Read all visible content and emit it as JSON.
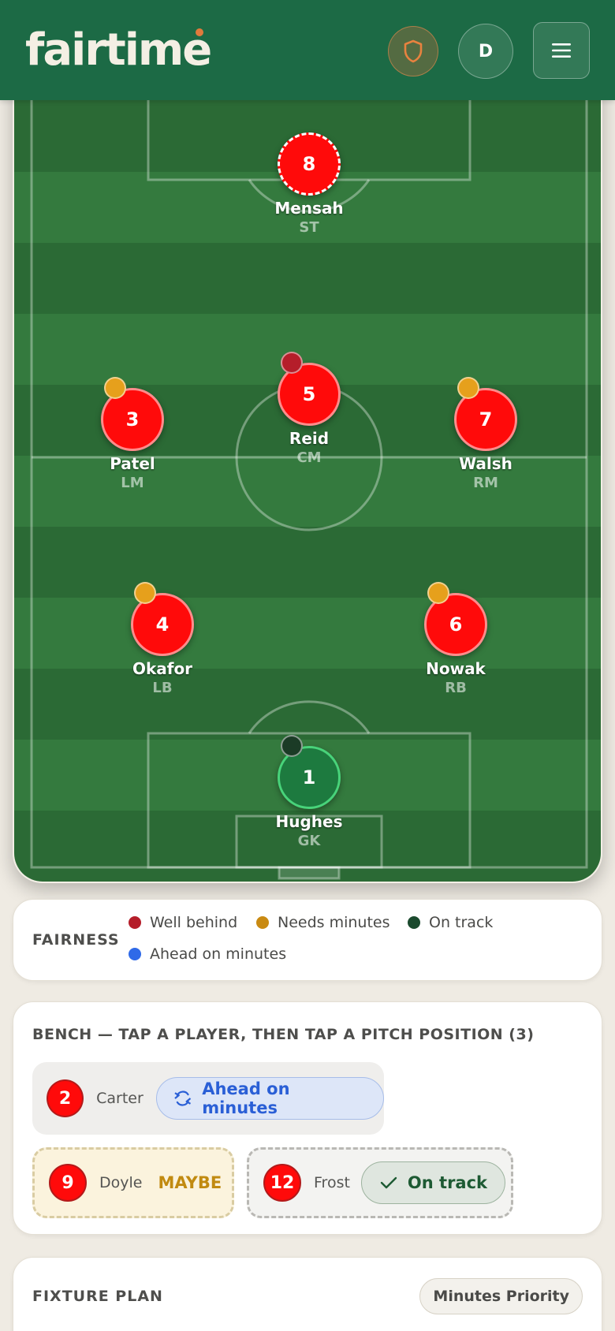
{
  "header": {
    "logo": "fairtime",
    "user_initial": "D",
    "icons": {
      "shield": "shield-icon",
      "menu": "hamburger-menu-icon"
    }
  },
  "pitch": {
    "players": [
      {
        "number": "8",
        "name": "Mensah",
        "position": "ST",
        "style": "dashed",
        "dot": "none"
      },
      {
        "number": "5",
        "name": "Reid",
        "position": "CM",
        "style": "normal",
        "dot": "red"
      },
      {
        "number": "3",
        "name": "Patel",
        "position": "LM",
        "style": "normal",
        "dot": "amber"
      },
      {
        "number": "7",
        "name": "Walsh",
        "position": "RM",
        "style": "normal",
        "dot": "amber"
      },
      {
        "number": "4",
        "name": "Okafor",
        "position": "LB",
        "style": "normal",
        "dot": "amber"
      },
      {
        "number": "6",
        "name": "Nowak",
        "position": "RB",
        "style": "normal",
        "dot": "amber"
      },
      {
        "number": "1",
        "name": "Hughes",
        "position": "GK",
        "style": "keeper",
        "dot": "dark"
      }
    ]
  },
  "fairness": {
    "title": "FAIRNESS",
    "legend": [
      {
        "label": "Well behind",
        "color": "#b51e2a"
      },
      {
        "label": "Needs minutes",
        "color": "#c98a12"
      },
      {
        "label": "On track",
        "color": "#1b4a2e"
      },
      {
        "label": "Ahead on minutes",
        "color": "#2f6ae8"
      }
    ]
  },
  "bench": {
    "title": "BENCH — TAP A PLAYER, THEN TAP A PITCH POSITION (3)",
    "players": [
      {
        "number": "2",
        "name": "Carter",
        "status": "Ahead on minutes"
      },
      {
        "number": "9",
        "name": "Doyle",
        "status": "MAYBE"
      },
      {
        "number": "12",
        "name": "Frost",
        "status": "On track"
      }
    ]
  },
  "fixture": {
    "title": "FIXTURE PLAN",
    "mode": "Minutes Priority"
  }
}
